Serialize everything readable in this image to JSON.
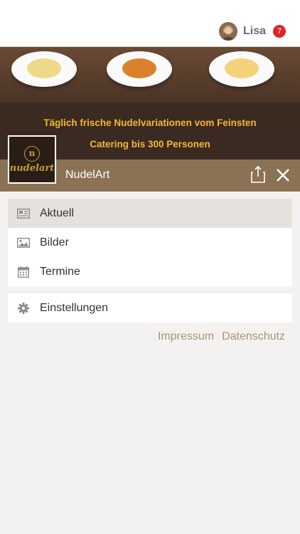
{
  "user": {
    "name": "Lisa",
    "notification_count": "7"
  },
  "banner": {
    "line1": "Täglich frische Nudelvariationen vom Feinsten",
    "line2": "Catering bis 300 Personen"
  },
  "logo": {
    "mark": "n",
    "text": "nudelart"
  },
  "header": {
    "title": "NudelArt"
  },
  "menu": {
    "items": [
      {
        "label": "Aktuell",
        "icon": "newspaper-icon",
        "active": true
      },
      {
        "label": "Bilder",
        "icon": "image-icon",
        "active": false
      },
      {
        "label": "Termine",
        "icon": "calendar-icon",
        "active": false
      }
    ],
    "settings": {
      "label": "Einstellungen",
      "icon": "gear-icon"
    }
  },
  "footer_links": {
    "impressum": "Impressum",
    "datenschutz": "Datenschutz"
  },
  "colors": {
    "header": "#8b7254",
    "active_item": "#e6e1dc",
    "badge": "#e02424",
    "link": "#a99479",
    "banner_text": "#f2b736"
  }
}
